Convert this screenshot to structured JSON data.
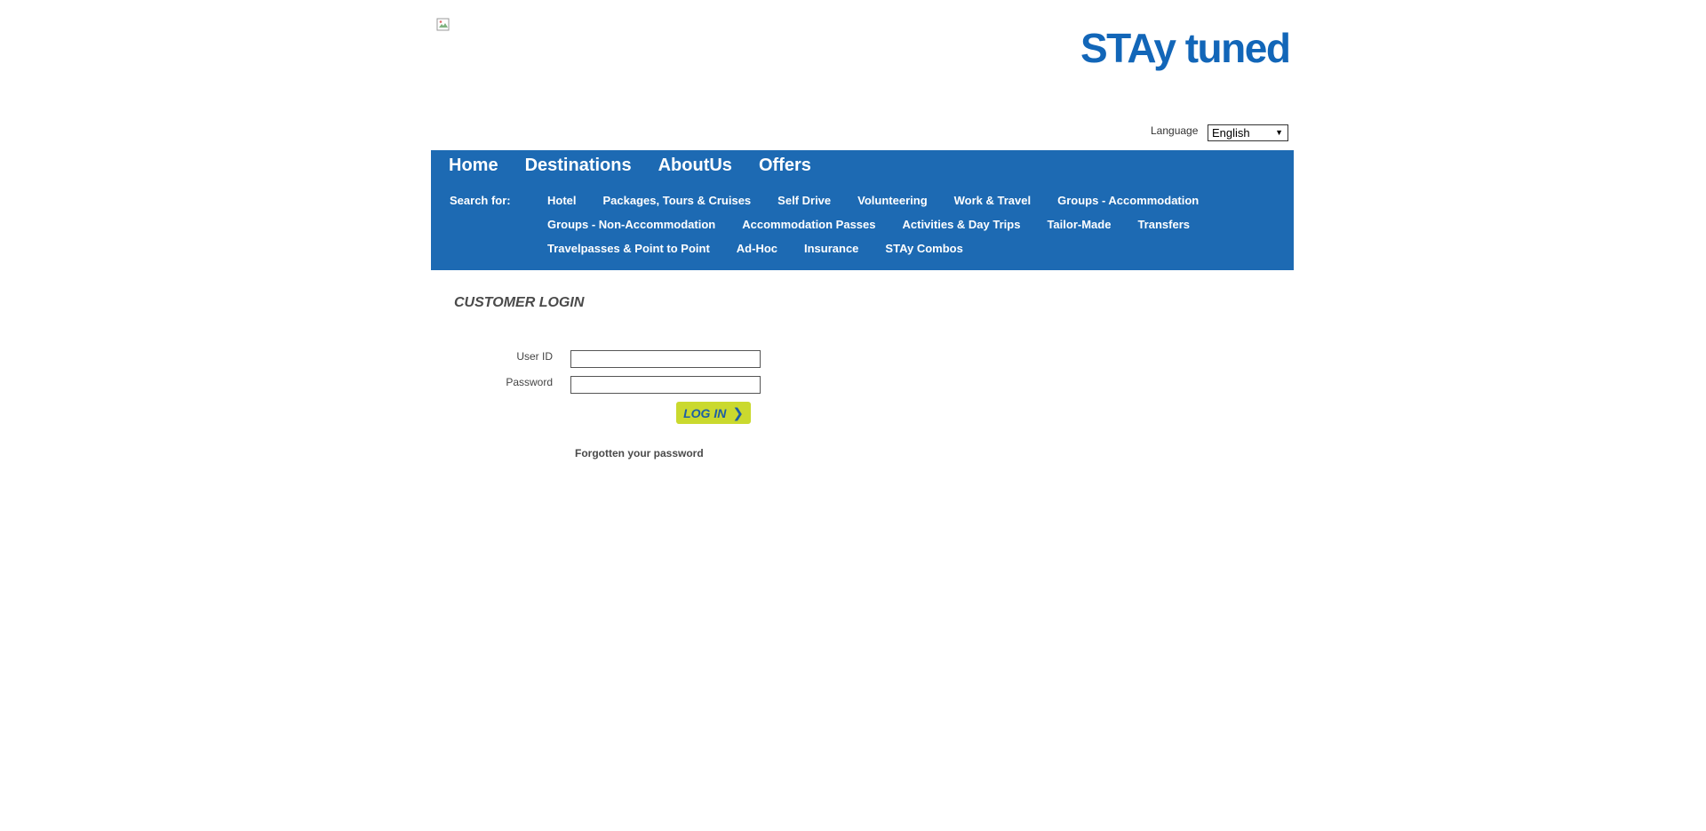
{
  "header": {
    "logo_text": "STAy tuned",
    "language_label": "Language",
    "language_selected": "English"
  },
  "nav": {
    "main_items": [
      "Home",
      "Destinations",
      "AboutUs",
      "Offers"
    ],
    "search_for_label": "Search for:",
    "search_rows": [
      [
        "Hotel",
        "Packages, Tours & Cruises",
        "Self Drive",
        "Volunteering",
        "Work & Travel",
        "Groups - Accommodation"
      ],
      [
        "Groups - Non-Accommodation",
        "Accommodation Passes",
        "Activities & Day Trips",
        "Tailor-Made",
        "Transfers"
      ],
      [
        "Travelpasses & Point to Point",
        "Ad-Hoc",
        "Insurance",
        "STAy Combos"
      ]
    ]
  },
  "login": {
    "title": "CUSTOMER LOGIN",
    "userid_label": "User ID",
    "userid_value": "",
    "password_label": "Password",
    "password_value": "",
    "button_label": "LOG IN",
    "forgot_label": "Forgotten your password"
  },
  "colors": {
    "nav_bg": "#1d6ab3",
    "button_bg": "#cad92e",
    "logo_blue": "#1266b8"
  }
}
